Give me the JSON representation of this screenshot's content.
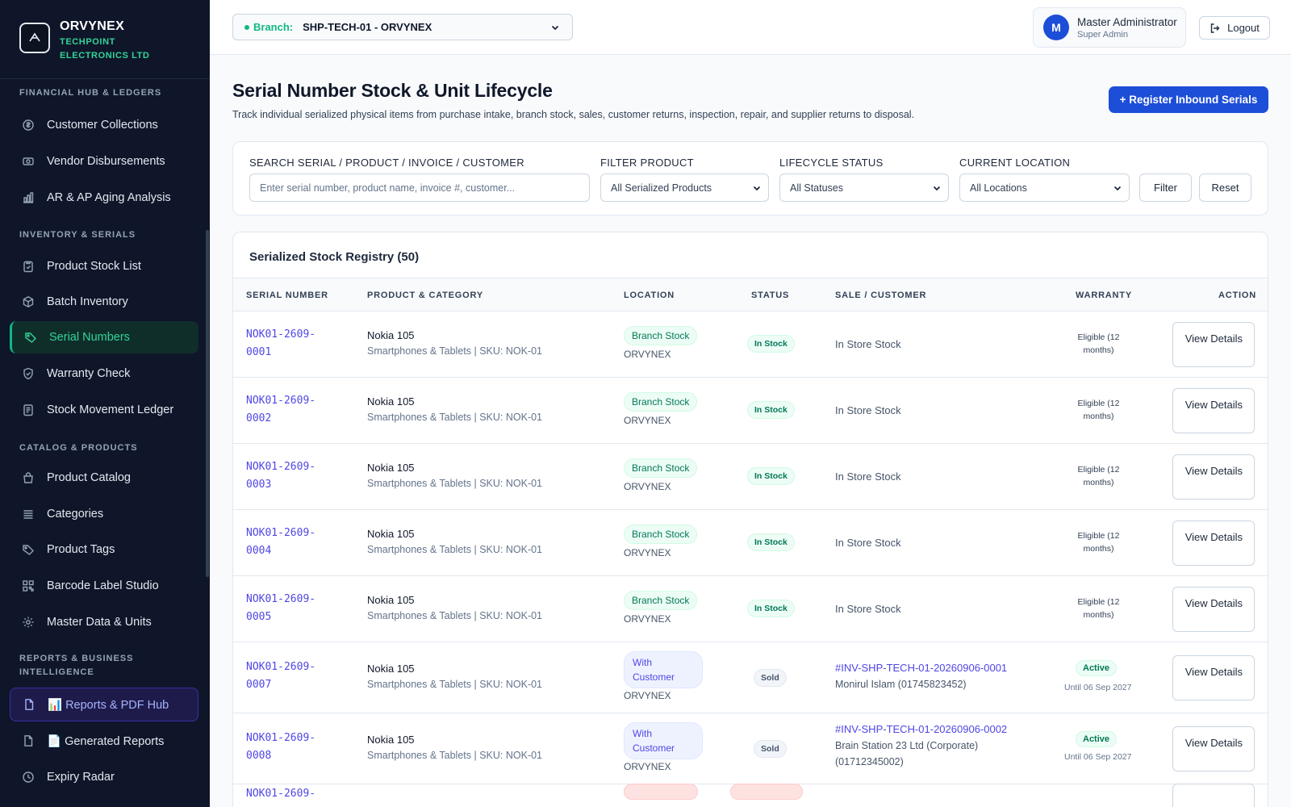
{
  "brand": {
    "name": "ORVYNEX",
    "company": "TECHPOINT ELECTRONICS LTD"
  },
  "sidebar": {
    "sections": [
      {
        "title": "FINANCIAL HUB & LEDGERS"
      },
      {
        "title": "INVENTORY & SERIALS"
      },
      {
        "title": "CATALOG & PRODUCTS"
      },
      {
        "title": "REPORTS & BUSINESS INTELLIGENCE"
      }
    ],
    "items": [
      {
        "label": "Customer Collections",
        "icon": "coin-icon"
      },
      {
        "label": "Vendor Disbursements",
        "icon": "cash-icon"
      },
      {
        "label": "AR & AP Aging Analysis",
        "icon": "bar-chart-icon"
      },
      {
        "label": "Product Stock List",
        "icon": "clipboard-icon"
      },
      {
        "label": "Batch Inventory",
        "icon": "box-icon"
      },
      {
        "label": "Serial Numbers",
        "icon": "tag-icon",
        "active": true
      },
      {
        "label": "Warranty Check",
        "icon": "shield-check-icon"
      },
      {
        "label": "Stock Movement Ledger",
        "icon": "ledger-icon"
      },
      {
        "label": "Product Catalog",
        "icon": "bag-icon"
      },
      {
        "label": "Categories",
        "icon": "list-icon"
      },
      {
        "label": "Product Tags",
        "icon": "tag-icon"
      },
      {
        "label": "Barcode Label Studio",
        "icon": "qr-icon"
      },
      {
        "label": "Master Data & Units",
        "icon": "gear-icon"
      },
      {
        "label": "📊 Reports & PDF Hub",
        "icon": "document-icon",
        "active": true
      },
      {
        "label": "📄 Generated Reports",
        "icon": "document-icon"
      },
      {
        "label": "Expiry Radar",
        "icon": "clock-icon"
      }
    ]
  },
  "topbar": {
    "branch_label": "Branch:",
    "branch_value": "SHP-TECH-01 - ORVYNEX",
    "user_initial": "M",
    "user_name": "Master Administrator",
    "user_role": "Super Admin",
    "logout_label": "Logout"
  },
  "page": {
    "title": "Serial Number Stock & Unit Lifecycle",
    "description": "Track individual serialized physical items from purchase intake, branch stock, sales, customer returns, inspection, repair, and supplier returns to disposal.",
    "register_button": "+ Register Inbound Serials"
  },
  "filters": {
    "search_label": "SEARCH SERIAL / PRODUCT / INVOICE / CUSTOMER",
    "search_placeholder": "Enter serial number, product name, invoice #, customer...",
    "product_label": "FILTER PRODUCT",
    "product_value": "All Serialized Products",
    "status_label": "LIFECYCLE STATUS",
    "status_value": "All Statuses",
    "location_label": "CURRENT LOCATION",
    "location_value": "All Locations",
    "filter_button": "Filter",
    "reset_button": "Reset"
  },
  "table": {
    "title": "Serialized Stock Registry (50)",
    "columns": [
      "SERIAL NUMBER",
      "PRODUCT & CATEGORY",
      "LOCATION",
      "STATUS",
      "SALE / CUSTOMER",
      "WARRANTY",
      "ACTION"
    ],
    "rows": [
      {
        "serial_a": "NOK01-2609-",
        "serial_b": "0001",
        "product": "Nokia 105",
        "category": "Smartphones & Tablets | SKU: NOK-01",
        "location": "Branch Stock",
        "location_sub": "ORVYNEX",
        "status": "In Stock",
        "sale": "In Store Stock",
        "warranty": "Eligible (12 months)",
        "action": "View Details"
      },
      {
        "serial_a": "NOK01-2609-",
        "serial_b": "0002",
        "product": "Nokia 105",
        "category": "Smartphones & Tablets | SKU: NOK-01",
        "location": "Branch Stock",
        "location_sub": "ORVYNEX",
        "status": "In Stock",
        "sale": "In Store Stock",
        "warranty": "Eligible (12 months)",
        "action": "View Details"
      },
      {
        "serial_a": "NOK01-2609-",
        "serial_b": "0003",
        "product": "Nokia 105",
        "category": "Smartphones & Tablets | SKU: NOK-01",
        "location": "Branch Stock",
        "location_sub": "ORVYNEX",
        "status": "In Stock",
        "sale": "In Store Stock",
        "warranty": "Eligible (12 months)",
        "action": "View Details"
      },
      {
        "serial_a": "NOK01-2609-",
        "serial_b": "0004",
        "product": "Nokia 105",
        "category": "Smartphones & Tablets | SKU: NOK-01",
        "location": "Branch Stock",
        "location_sub": "ORVYNEX",
        "status": "In Stock",
        "sale": "In Store Stock",
        "warranty": "Eligible (12 months)",
        "action": "View Details"
      },
      {
        "serial_a": "NOK01-2609-",
        "serial_b": "0005",
        "product": "Nokia 105",
        "category": "Smartphones & Tablets | SKU: NOK-01",
        "location": "Branch Stock",
        "location_sub": "ORVYNEX",
        "status": "In Stock",
        "sale": "In Store Stock",
        "warranty": "Eligible (12 months)",
        "action": "View Details"
      },
      {
        "serial_a": "NOK01-2609-",
        "serial_b": "0007",
        "product": "Nokia 105",
        "category": "Smartphones & Tablets | SKU: NOK-01",
        "location": "With Customer",
        "location_sub": "ORVYNEX",
        "status": "Sold",
        "invoice": "#INV-SHP-TECH-01-20260906-0001",
        "customer": "Monirul Islam (01745823452)",
        "warranty_status": "Active",
        "warranty_until": "Until 06 Sep 2027",
        "action": "View Details"
      },
      {
        "serial_a": "NOK01-2609-",
        "serial_b": "0008",
        "product": "Nokia 105",
        "category": "Smartphones & Tablets | SKU: NOK-01",
        "location": "With Customer",
        "location_sub": "ORVYNEX",
        "status": "Sold",
        "invoice": "#INV-SHP-TECH-01-20260906-0002",
        "customer": "Brain Station 23 Ltd (Corporate) (01712345002)",
        "warranty_status": "Active",
        "warranty_until": "Until 06 Sep 2027",
        "action": "View Details"
      }
    ],
    "peek_serial": "NOK01-2609-"
  },
  "colors": {
    "accent": "#1d4ed8",
    "sidebar_bg": "#0f1629",
    "success": "#10b981",
    "link": "#4f46e5"
  }
}
